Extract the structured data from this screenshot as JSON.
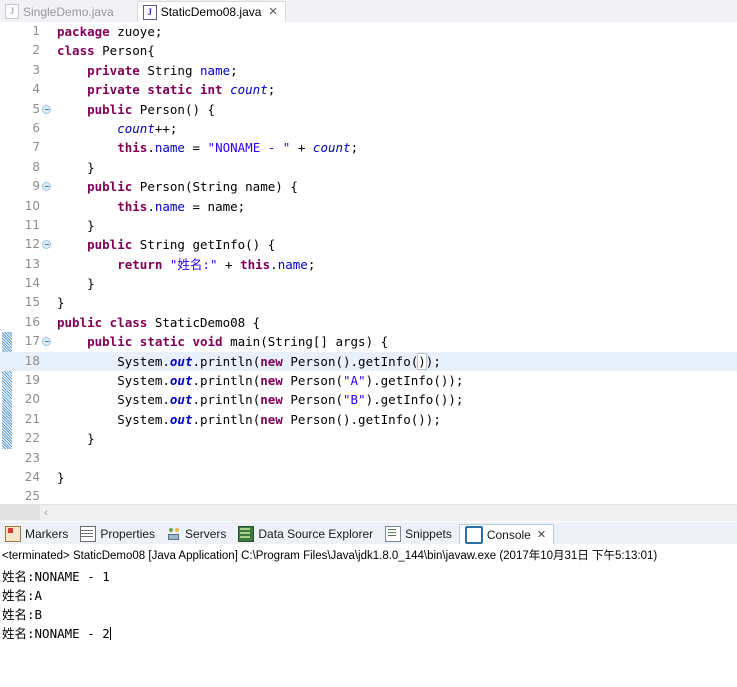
{
  "editor_tabs": [
    {
      "label": "SingleDemo.java",
      "icon": "java-file-icon",
      "active": false,
      "closable": false
    },
    {
      "label": "StaticDemo08.java",
      "icon": "java-file-icon",
      "active": true,
      "closable": true,
      "close_glyph": "✕"
    }
  ],
  "code": {
    "lines": [
      {
        "num": "1",
        "fold": false,
        "changed": false,
        "highlight": false,
        "tokens": [
          {
            "t": "package ",
            "c": "kw"
          },
          {
            "t": "zuoye;",
            "c": "plain"
          }
        ]
      },
      {
        "num": "2",
        "fold": false,
        "changed": false,
        "highlight": false,
        "tokens": [
          {
            "t": "class ",
            "c": "kw"
          },
          {
            "t": "Person{",
            "c": "plain"
          }
        ]
      },
      {
        "num": "3",
        "fold": false,
        "changed": false,
        "highlight": false,
        "tokens": [
          {
            "t": "    ",
            "c": "plain"
          },
          {
            "t": "private ",
            "c": "kw"
          },
          {
            "t": "String ",
            "c": "plain"
          },
          {
            "t": "name",
            "c": "fld"
          },
          {
            "t": ";",
            "c": "plain"
          }
        ]
      },
      {
        "num": "4",
        "fold": false,
        "changed": false,
        "highlight": false,
        "tokens": [
          {
            "t": "    ",
            "c": "plain"
          },
          {
            "t": "private static int ",
            "c": "kw"
          },
          {
            "t": "count",
            "c": "sfld"
          },
          {
            "t": ";",
            "c": "plain"
          }
        ]
      },
      {
        "num": "5",
        "fold": true,
        "changed": false,
        "highlight": false,
        "tokens": [
          {
            "t": "    ",
            "c": "plain"
          },
          {
            "t": "public ",
            "c": "kw"
          },
          {
            "t": "Person() {",
            "c": "plain"
          }
        ]
      },
      {
        "num": "6",
        "fold": false,
        "changed": false,
        "highlight": false,
        "tokens": [
          {
            "t": "        ",
            "c": "plain"
          },
          {
            "t": "count",
            "c": "sfld"
          },
          {
            "t": "++;",
            "c": "plain"
          }
        ]
      },
      {
        "num": "7",
        "fold": false,
        "changed": false,
        "highlight": false,
        "tokens": [
          {
            "t": "        ",
            "c": "plain"
          },
          {
            "t": "this",
            "c": "kw"
          },
          {
            "t": ".",
            "c": "plain"
          },
          {
            "t": "name",
            "c": "fld"
          },
          {
            "t": " = ",
            "c": "plain"
          },
          {
            "t": "\"NONAME - \"",
            "c": "str"
          },
          {
            "t": " + ",
            "c": "plain"
          },
          {
            "t": "count",
            "c": "sfld"
          },
          {
            "t": ";",
            "c": "plain"
          }
        ]
      },
      {
        "num": "8",
        "fold": false,
        "changed": false,
        "highlight": false,
        "tokens": [
          {
            "t": "    }",
            "c": "plain"
          }
        ]
      },
      {
        "num": "9",
        "fold": true,
        "changed": false,
        "highlight": false,
        "tokens": [
          {
            "t": "    ",
            "c": "plain"
          },
          {
            "t": "public ",
            "c": "kw"
          },
          {
            "t": "Person(String ",
            "c": "plain"
          },
          {
            "t": "name",
            "c": "plain"
          },
          {
            "t": ") {",
            "c": "plain"
          }
        ]
      },
      {
        "num": "10",
        "fold": false,
        "changed": false,
        "highlight": false,
        "tokens": [
          {
            "t": "        ",
            "c": "plain"
          },
          {
            "t": "this",
            "c": "kw"
          },
          {
            "t": ".",
            "c": "plain"
          },
          {
            "t": "name",
            "c": "fld"
          },
          {
            "t": " = name;",
            "c": "plain"
          }
        ]
      },
      {
        "num": "11",
        "fold": false,
        "changed": false,
        "highlight": false,
        "tokens": [
          {
            "t": "    }",
            "c": "plain"
          }
        ]
      },
      {
        "num": "12",
        "fold": true,
        "changed": false,
        "highlight": false,
        "tokens": [
          {
            "t": "    ",
            "c": "plain"
          },
          {
            "t": "public ",
            "c": "kw"
          },
          {
            "t": "String getInfo() {",
            "c": "plain"
          }
        ]
      },
      {
        "num": "13",
        "fold": false,
        "changed": false,
        "highlight": false,
        "tokens": [
          {
            "t": "        ",
            "c": "plain"
          },
          {
            "t": "return ",
            "c": "kw"
          },
          {
            "t": "\"姓名:\"",
            "c": "str"
          },
          {
            "t": " + ",
            "c": "plain"
          },
          {
            "t": "this",
            "c": "kw"
          },
          {
            "t": ".",
            "c": "plain"
          },
          {
            "t": "name",
            "c": "fld"
          },
          {
            "t": ";",
            "c": "plain"
          }
        ]
      },
      {
        "num": "14",
        "fold": false,
        "changed": false,
        "highlight": false,
        "tokens": [
          {
            "t": "    }",
            "c": "plain"
          }
        ]
      },
      {
        "num": "15",
        "fold": false,
        "changed": false,
        "highlight": false,
        "tokens": [
          {
            "t": "}",
            "c": "plain"
          }
        ]
      },
      {
        "num": "16",
        "fold": false,
        "changed": false,
        "highlight": false,
        "tokens": [
          {
            "t": "public class ",
            "c": "kw"
          },
          {
            "t": "StaticDemo08 {",
            "c": "plain"
          }
        ]
      },
      {
        "num": "17",
        "fold": true,
        "changed": true,
        "highlight": false,
        "tokens": [
          {
            "t": "    ",
            "c": "plain"
          },
          {
            "t": "public static void ",
            "c": "kw"
          },
          {
            "t": "main(String[] ",
            "c": "plain"
          },
          {
            "t": "args",
            "c": "plain"
          },
          {
            "t": ") {",
            "c": "plain"
          }
        ]
      },
      {
        "num": "18",
        "fold": false,
        "changed": true,
        "highlight": true,
        "tokens": [
          {
            "t": "        ",
            "c": "plain"
          },
          {
            "t": "System.",
            "c": "plain"
          },
          {
            "t": "out",
            "c": "sfldb"
          },
          {
            "t": ".println(",
            "c": "plain"
          },
          {
            "t": "new ",
            "c": "kw"
          },
          {
            "t": "Person().getInfo(",
            "c": "plain"
          },
          {
            "t": ")",
            "c": "brkt"
          },
          {
            "t": ");",
            "c": "plain"
          }
        ]
      },
      {
        "num": "19",
        "fold": false,
        "changed": true,
        "highlight": false,
        "tokens": [
          {
            "t": "        ",
            "c": "plain"
          },
          {
            "t": "System.",
            "c": "plain"
          },
          {
            "t": "out",
            "c": "sfldb"
          },
          {
            "t": ".println(",
            "c": "plain"
          },
          {
            "t": "new ",
            "c": "kw"
          },
          {
            "t": "Person(",
            "c": "plain"
          },
          {
            "t": "\"A\"",
            "c": "str"
          },
          {
            "t": ").getInfo());",
            "c": "plain"
          }
        ]
      },
      {
        "num": "20",
        "fold": false,
        "changed": true,
        "highlight": false,
        "tokens": [
          {
            "t": "        ",
            "c": "plain"
          },
          {
            "t": "System.",
            "c": "plain"
          },
          {
            "t": "out",
            "c": "sfldb"
          },
          {
            "t": ".println(",
            "c": "plain"
          },
          {
            "t": "new ",
            "c": "kw"
          },
          {
            "t": "Person(",
            "c": "plain"
          },
          {
            "t": "\"B\"",
            "c": "str"
          },
          {
            "t": ").getInfo());",
            "c": "plain"
          }
        ]
      },
      {
        "num": "21",
        "fold": false,
        "changed": true,
        "highlight": false,
        "tokens": [
          {
            "t": "        ",
            "c": "plain"
          },
          {
            "t": "System.",
            "c": "plain"
          },
          {
            "t": "out",
            "c": "sfldb"
          },
          {
            "t": ".println(",
            "c": "plain"
          },
          {
            "t": "new ",
            "c": "kw"
          },
          {
            "t": "Person().getInfo());",
            "c": "plain"
          }
        ]
      },
      {
        "num": "22",
        "fold": false,
        "changed": true,
        "highlight": false,
        "tokens": [
          {
            "t": "    }",
            "c": "plain"
          }
        ]
      },
      {
        "num": "23",
        "fold": false,
        "changed": false,
        "highlight": false,
        "tokens": [
          {
            "t": "",
            "c": "plain"
          }
        ]
      },
      {
        "num": "24",
        "fold": false,
        "changed": false,
        "highlight": false,
        "tokens": [
          {
            "t": "}",
            "c": "plain"
          }
        ]
      },
      {
        "num": "25",
        "fold": false,
        "changed": false,
        "highlight": false,
        "tokens": [
          {
            "t": "",
            "c": "plain"
          }
        ]
      }
    ]
  },
  "editor_scrollbar": {
    "left_arrow_glyph": "‹"
  },
  "console_tabs": [
    {
      "label": "Markers",
      "icon": "markers-icon",
      "active": false
    },
    {
      "label": "Properties",
      "icon": "properties-icon",
      "active": false
    },
    {
      "label": "Servers",
      "icon": "servers-icon",
      "active": false
    },
    {
      "label": "Data Source Explorer",
      "icon": "data-source-explorer-icon",
      "active": false
    },
    {
      "label": "Snippets",
      "icon": "snippets-icon",
      "active": false
    },
    {
      "label": "Console",
      "icon": "console-icon",
      "active": true,
      "close_glyph": "✕"
    }
  ],
  "console": {
    "terminated_line": "<terminated> StaticDemo08 [Java Application] C:\\Program Files\\Java\\jdk1.8.0_144\\bin\\javaw.exe (2017年10月31日 下午5:13:01)",
    "output": [
      "姓名:NONAME - 1",
      "姓名:A",
      "姓名:B",
      "姓名:NONAME - 2"
    ]
  },
  "colors": {
    "keyword": "#7f0055",
    "string": "#2a00ff",
    "field": "#0000c0",
    "highlight_row": "#e8f0fb",
    "change_bar": "#5b9bd5",
    "tab_active_bg": "#ffffff",
    "panel_bg": "#eef1f7"
  }
}
